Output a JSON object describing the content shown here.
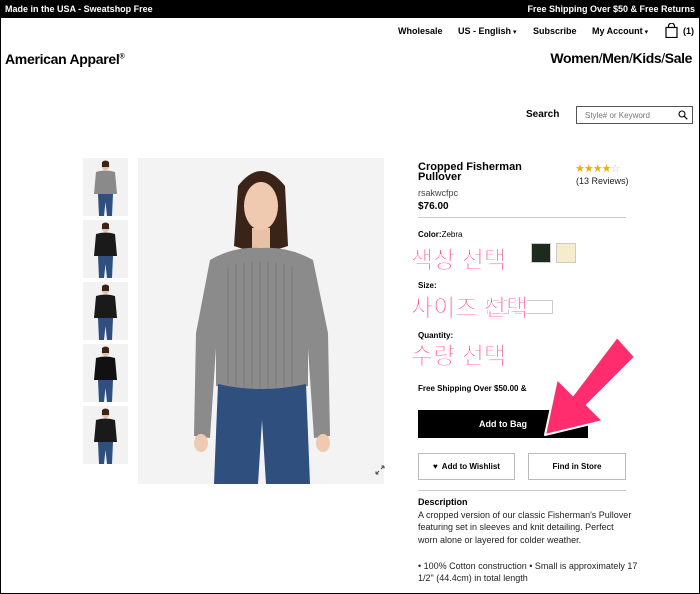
{
  "top_banner": {
    "left_text": "Made in the USA - Sweatshop Free",
    "right_text": "Free Shipping Over $50 & Free Returns"
  },
  "utility_nav": {
    "wholesale": "Wholesale",
    "locale": "US - English",
    "subscribe": "Subscribe",
    "account": "My Account",
    "bag_count": "(1)"
  },
  "header": {
    "logo": "American Apparel",
    "logo_mark": "®",
    "nav": [
      "Women",
      "Men",
      "Kids",
      "Sale"
    ],
    "nav_sep": "/"
  },
  "search": {
    "label": "Search",
    "placeholder": "Style# or Keyword"
  },
  "product": {
    "title": "Cropped Fisherman Pullover",
    "sku": "rsakwcfpc",
    "price": "$76.00",
    "rating": 4,
    "rating_max": 5,
    "reviews": "(13 Reviews)",
    "color_label": "Color:",
    "color_value": "Zebra",
    "swatch_colors": [
      "#1f2a1f",
      "#f4eccb"
    ],
    "size_label": "Size:",
    "qty_label": "Quantity:",
    "shipping_note": "Free Shipping Over $50.00 &",
    "add_to_bag": "Add to Bag",
    "wishlist": "Add to Wishlist",
    "find_store": "Find in Store",
    "description_heading": "Description",
    "description": "A cropped version of our classic Fisherman's Pullover featuring set in sleeves and knit detailing. Perfect worn alone or layered for colder weather.",
    "bullet": "• 100% Cotton construction • Small is approximately 17 1/2\" (44.4cm) in total length"
  },
  "annotations": {
    "select_color": "색상 선택",
    "select_size": "사이즈 선택",
    "select_qty": "수량 선택",
    "accent": "#ff2d6e"
  },
  "thumbnails": [
    {
      "sweater": "#8a8a8a",
      "view": "front"
    },
    {
      "sweater": "#1a1a1a",
      "view": "front"
    },
    {
      "sweater": "#1a1a1a",
      "view": "side"
    },
    {
      "sweater": "#111111",
      "view": "front"
    },
    {
      "sweater": "#1a1a1a",
      "view": "full"
    }
  ]
}
